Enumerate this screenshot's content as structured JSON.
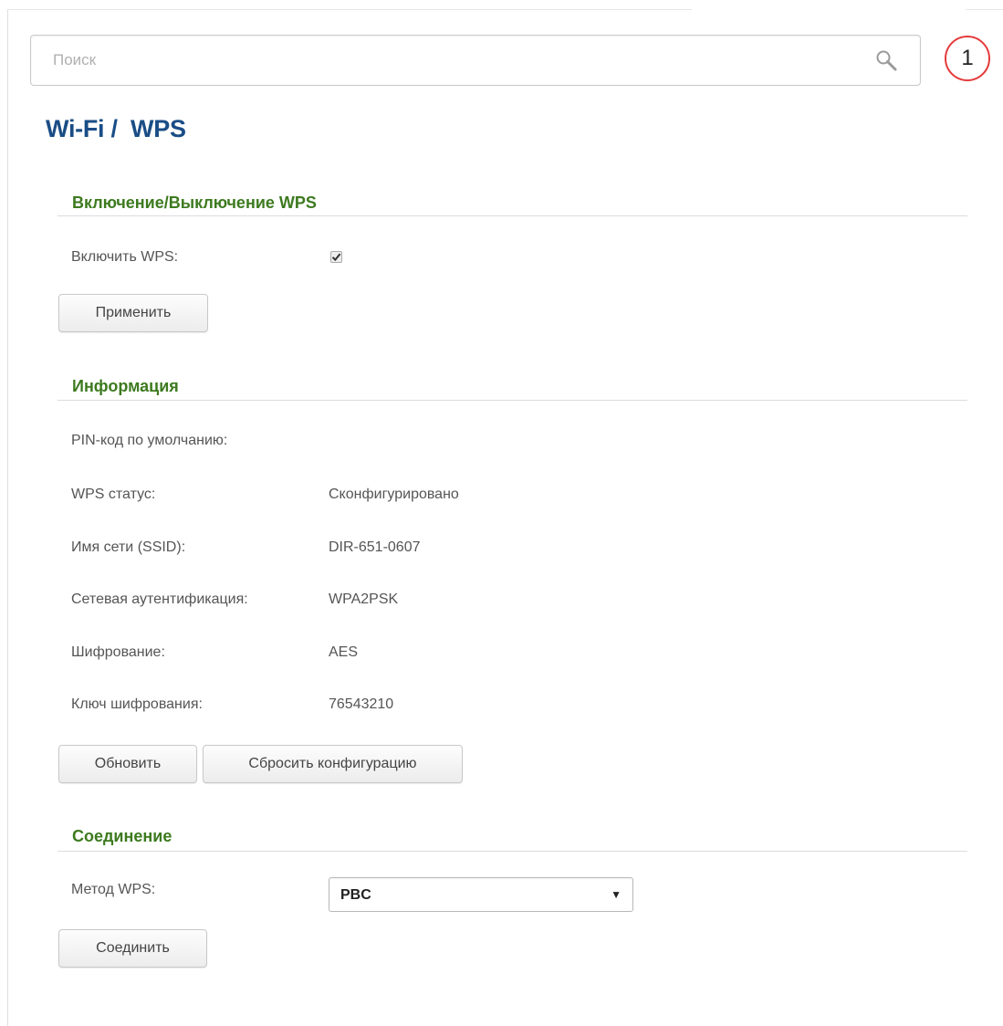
{
  "search": {
    "placeholder": "Поиск"
  },
  "notifications": {
    "count": "1"
  },
  "breadcrumb": {
    "section": "Wi-Fi",
    "separator": "/",
    "page": "WPS"
  },
  "enable_section": {
    "title": "Включение/Выключение WPS",
    "enable_label": "Включить WPS:",
    "enabled": true,
    "apply_label": "Применить"
  },
  "info_section": {
    "title": "Информация",
    "rows": [
      {
        "label": "PIN-код по умолчанию:",
        "value": ""
      },
      {
        "label": "WPS статус:",
        "value": "Сконфигурировано"
      },
      {
        "label": "Имя сети (SSID):",
        "value": "DIR-651-0607"
      },
      {
        "label": "Сетевая аутентификация:",
        "value": "WPA2PSK"
      },
      {
        "label": "Шифрование:",
        "value": "AES"
      },
      {
        "label": "Ключ шифрования:",
        "value": "76543210"
      }
    ],
    "refresh_label": "Обновить",
    "reset_label": "Сбросить конфигурацию"
  },
  "connect_section": {
    "title": "Соединение",
    "method_label": "Метод WPS:",
    "method_value": "PBC",
    "connect_label": "Соединить"
  }
}
